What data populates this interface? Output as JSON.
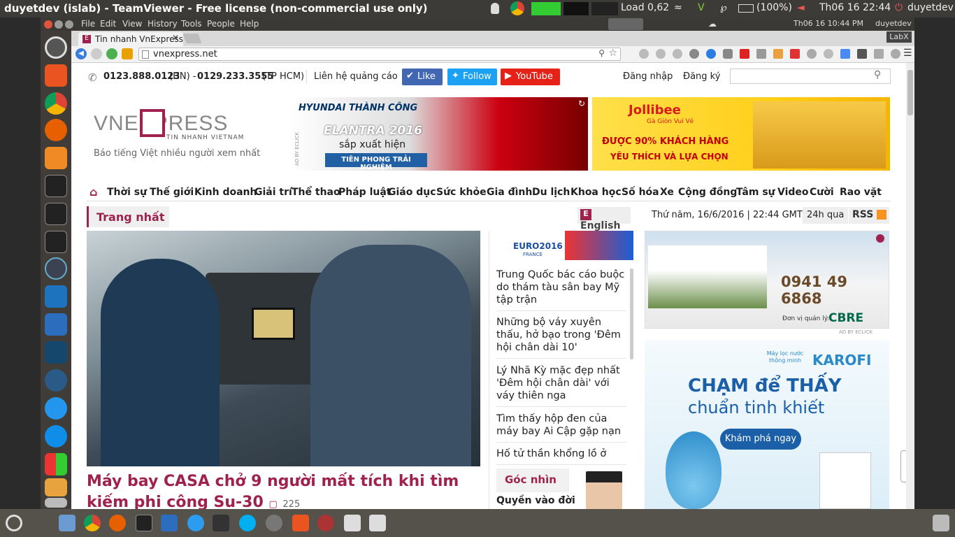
{
  "outer_bar": {
    "title": "duyetdev (islab) - TeamViewer - Free license (non-commercial use only)",
    "load": "Load 0,62",
    "battery": "(100%)",
    "datetime": "Th06 16 22:44",
    "user": "duyetdev"
  },
  "inner_bar": {
    "menu": [
      "File",
      "Edit",
      "View",
      "History",
      "Tools",
      "People",
      "Help"
    ],
    "datetime": "Th06 16 10:44 PM",
    "user": "duyetdev",
    "labx": "LabX"
  },
  "browser": {
    "tab_title": "Tin nhanh VnExpress",
    "url": "vnexpress.net"
  },
  "site": {
    "phone_hn": "0123.888.0123",
    "phone_hn_suffix": "(HN) -",
    "phone_hcm": "0129.233.3555",
    "phone_hcm_suffix": "(TP HCM)",
    "ads_contact": "Liên hệ quảng cáo",
    "like": "Like",
    "follow": "Follow",
    "youtube": "YouTube",
    "login": "Đăng nhập",
    "register": "Đăng ký",
    "logo_main": "VNEXPRESS",
    "logo_sub": "TIN NHANH VIETNAM",
    "tagline": "Báo tiếng Việt nhiều người xem nhất",
    "nav": [
      "Thời sự",
      "Thế giới",
      "Kinh doanh",
      "Giải trí",
      "Thể thao",
      "Pháp luật",
      "Giáo dục",
      "Sức khỏe",
      "Gia đình",
      "Du lịch",
      "Khoa học",
      "Số hóa",
      "Xe",
      "Cộng đồng",
      "Tâm sự",
      "Video",
      "Cười",
      "Rao vặt"
    ],
    "section_label": "Trang nhất",
    "english": "English",
    "date": "Thứ năm, 16/6/2016 | 22:44 GMT+7",
    "past24": "24h qua",
    "rss": "RSS",
    "headline": "Máy bay CASA chở 9 người mất tích khi tìm kiếm phi công Su-30",
    "comments": "225",
    "side_news": [
      "Trung Quốc bác cáo buộc do thám tàu sân bay Mỹ tập trận",
      "Những bộ váy xuyên thấu, hở bạo trong 'Đêm hội chân dài 10'",
      "Lý Nhã Kỳ mặc đẹp nhất 'Đêm hội chân dài' với váy thiên nga",
      "Tìm thấy hộp đen của máy bay Ai Cập gặp nạn",
      "Hố tử thần khổng lồ ở"
    ],
    "goc_nhin": "Góc nhìn",
    "goc_nhin_author": "Quyền vào đời",
    "euro_label": "EURO2016",
    "euro_country": "FRANCE"
  },
  "ads": {
    "hyundai_brand": "HYUNDAI THÀNH CÔNG",
    "hyundai_model": "ELANTRA 2016",
    "hyundai_text": "sắp xuất hiện",
    "hyundai_cta": "TIÊN PHONG TRẢI NGHIỆM",
    "ad_by": "AD BY ECLICK",
    "jollibee_brand": "Jollibee",
    "jollibee_sub": "Gà Giòn Vui Vẻ",
    "jollibee_line1": "ĐƯỢC 90% KHÁCH HÀNG",
    "jollibee_line2": "YÊU THÍCH VÀ LỰA CHỌN",
    "realestate_phone": "0941 49 6868",
    "realestate_manager": "Đơn vị quản lý:",
    "realestate_brand": "CBRE",
    "karofi_small": "Máy lọc nước thông minh",
    "karofi_brand": "KAROFI",
    "karofi_line1": "CHẠM để THẤY",
    "karofi_line2": "chuẩn tinh khiết",
    "karofi_cta": "Khám phá ngay"
  },
  "colors": {
    "brand": "#9f224e",
    "facebook": "#4267b2",
    "twitter": "#1da1f2",
    "youtube": "#e62117"
  }
}
